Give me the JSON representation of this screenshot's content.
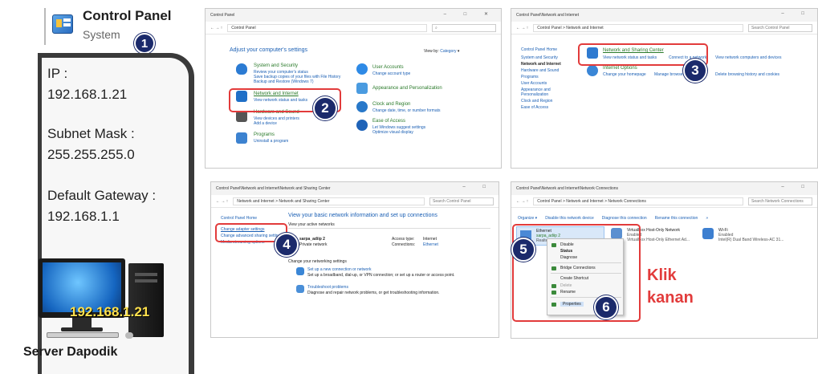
{
  "header": {
    "title": "Control Panel",
    "subtitle": "System"
  },
  "info": {
    "ip_label": "IP :",
    "ip_value": "192.168.1.21",
    "subnet_label": "Subnet Mask :",
    "subnet_value": "255.255.255.0",
    "gateway_label": "Default Gateway :",
    "gateway_value": "192.168.1.1"
  },
  "server": {
    "screen_ip": "192.168.1.21",
    "caption": "Server Dapodik"
  },
  "steps": [
    "1",
    "2",
    "3",
    "4",
    "5",
    "6"
  ],
  "klik": {
    "line1": "Klik",
    "line2": "kanan"
  },
  "win1": {
    "title": "Control Panel",
    "address": "Control Panel",
    "heading": "Adjust your computer's settings",
    "view_by": "View by:",
    "view_value": "Category",
    "left": [
      {
        "title": "System and Security",
        "l1": "Review your computer's status",
        "l2": "Save backup copies of your files with File History",
        "l3": "Backup and Restore (Windows 7)"
      },
      {
        "title": "Network and Internet",
        "l1": "View network status and tasks",
        "l2": "",
        "l3": ""
      },
      {
        "title": "Hardware and Sound",
        "l1": "View devices and printers",
        "l2": "Add a device",
        "l3": ""
      },
      {
        "title": "Programs",
        "l1": "Uninstall a program",
        "l2": "",
        "l3": ""
      }
    ],
    "right": [
      {
        "title": "User Accounts",
        "l1": "Change account type",
        "l2": ""
      },
      {
        "title": "Appearance and Personalization",
        "l1": "",
        "l2": ""
      },
      {
        "title": "Clock and Region",
        "l1": "Change date, time, or number formats",
        "l2": ""
      },
      {
        "title": "Ease of Access",
        "l1": "Let Windows suggest settings",
        "l2": "Optimize visual display"
      }
    ]
  },
  "win2": {
    "title": "Control Panel\\Network and Internet",
    "address": "Control Panel  >  Network and Internet",
    "search": "Search Control Panel",
    "sidebar": [
      "Control Panel Home",
      "System and Security",
      "Network and Internet",
      "Hardware and Sound",
      "Programs",
      "User Accounts",
      "Appearance and Personalization",
      "Clock and Region",
      "Ease of Access"
    ],
    "nsc_title": "Network and Sharing Center",
    "nsc_l1": "View network status and tasks",
    "nsc_l2": "Connect to a network",
    "nsc_l3": "View network computers and devices",
    "io_title": "Internet Options",
    "io_l1": "Change your homepage",
    "io_l2": "Manage browser add-ons",
    "io_l3": "Delete browsing history and cookies"
  },
  "win3": {
    "title": "Control Panel\\Network and Internet\\Network and Sharing Center",
    "address": "Network and Internet  >  Network and Sharing Center",
    "search": "Search Control Panel",
    "sidebar": [
      "Control Panel Home",
      "Change adapter settings",
      "Change advanced sharing settings",
      "Media streaming options"
    ],
    "heading": "View your basic network information and set up connections",
    "active": "View your active networks",
    "net_name": "sarpa_adiip 2",
    "net_type": "Private network",
    "access_label": "Access type:",
    "access_value": "Internet",
    "conn_label": "Connections:",
    "conn_value": "Ethernet",
    "change": "Change your networking settings",
    "s1_title": "Set up a new connection or network",
    "s1_desc": "Set up a broadband, dial-up, or VPN connection; or set up a router or access point.",
    "s2_title": "Troubleshoot problems",
    "s2_desc": "Diagnose and repair network problems, or get troubleshooting information."
  },
  "win4": {
    "title": "Control Panel\\Network and Internet\\Network Connections",
    "address": "Control Panel  >  Network and Internet  >  Network Connections",
    "search": "Search Network Connections",
    "toolbar": [
      "Organize ▾",
      "Disable this network device",
      "Diagnose this connection",
      "Rename this connection",
      "»"
    ],
    "adapters": [
      {
        "name": "Ethernet",
        "status": "sarpa_adiip 2",
        "device": "Realtek..."
      },
      {
        "name": "VirtualBox Host-Only Network",
        "status": "Enabled",
        "device": "VirtualBox Host-Only Ethernet Ad..."
      },
      {
        "name": "Wi-Fi",
        "status": "Enabled",
        "device": "Intel(R) Dual Band Wireless-AC 31..."
      }
    ],
    "menu": [
      "Disable",
      "Status",
      "Diagnose",
      "Bridge Connections",
      "Create Shortcut",
      "Delete",
      "Rename",
      "Properties"
    ]
  },
  "colors": {
    "navy": "#1b2a6b",
    "red": "#e23b3b",
    "panel_dark": "#2b2b2b",
    "screen_ip_yellow": "#ffe14d"
  }
}
